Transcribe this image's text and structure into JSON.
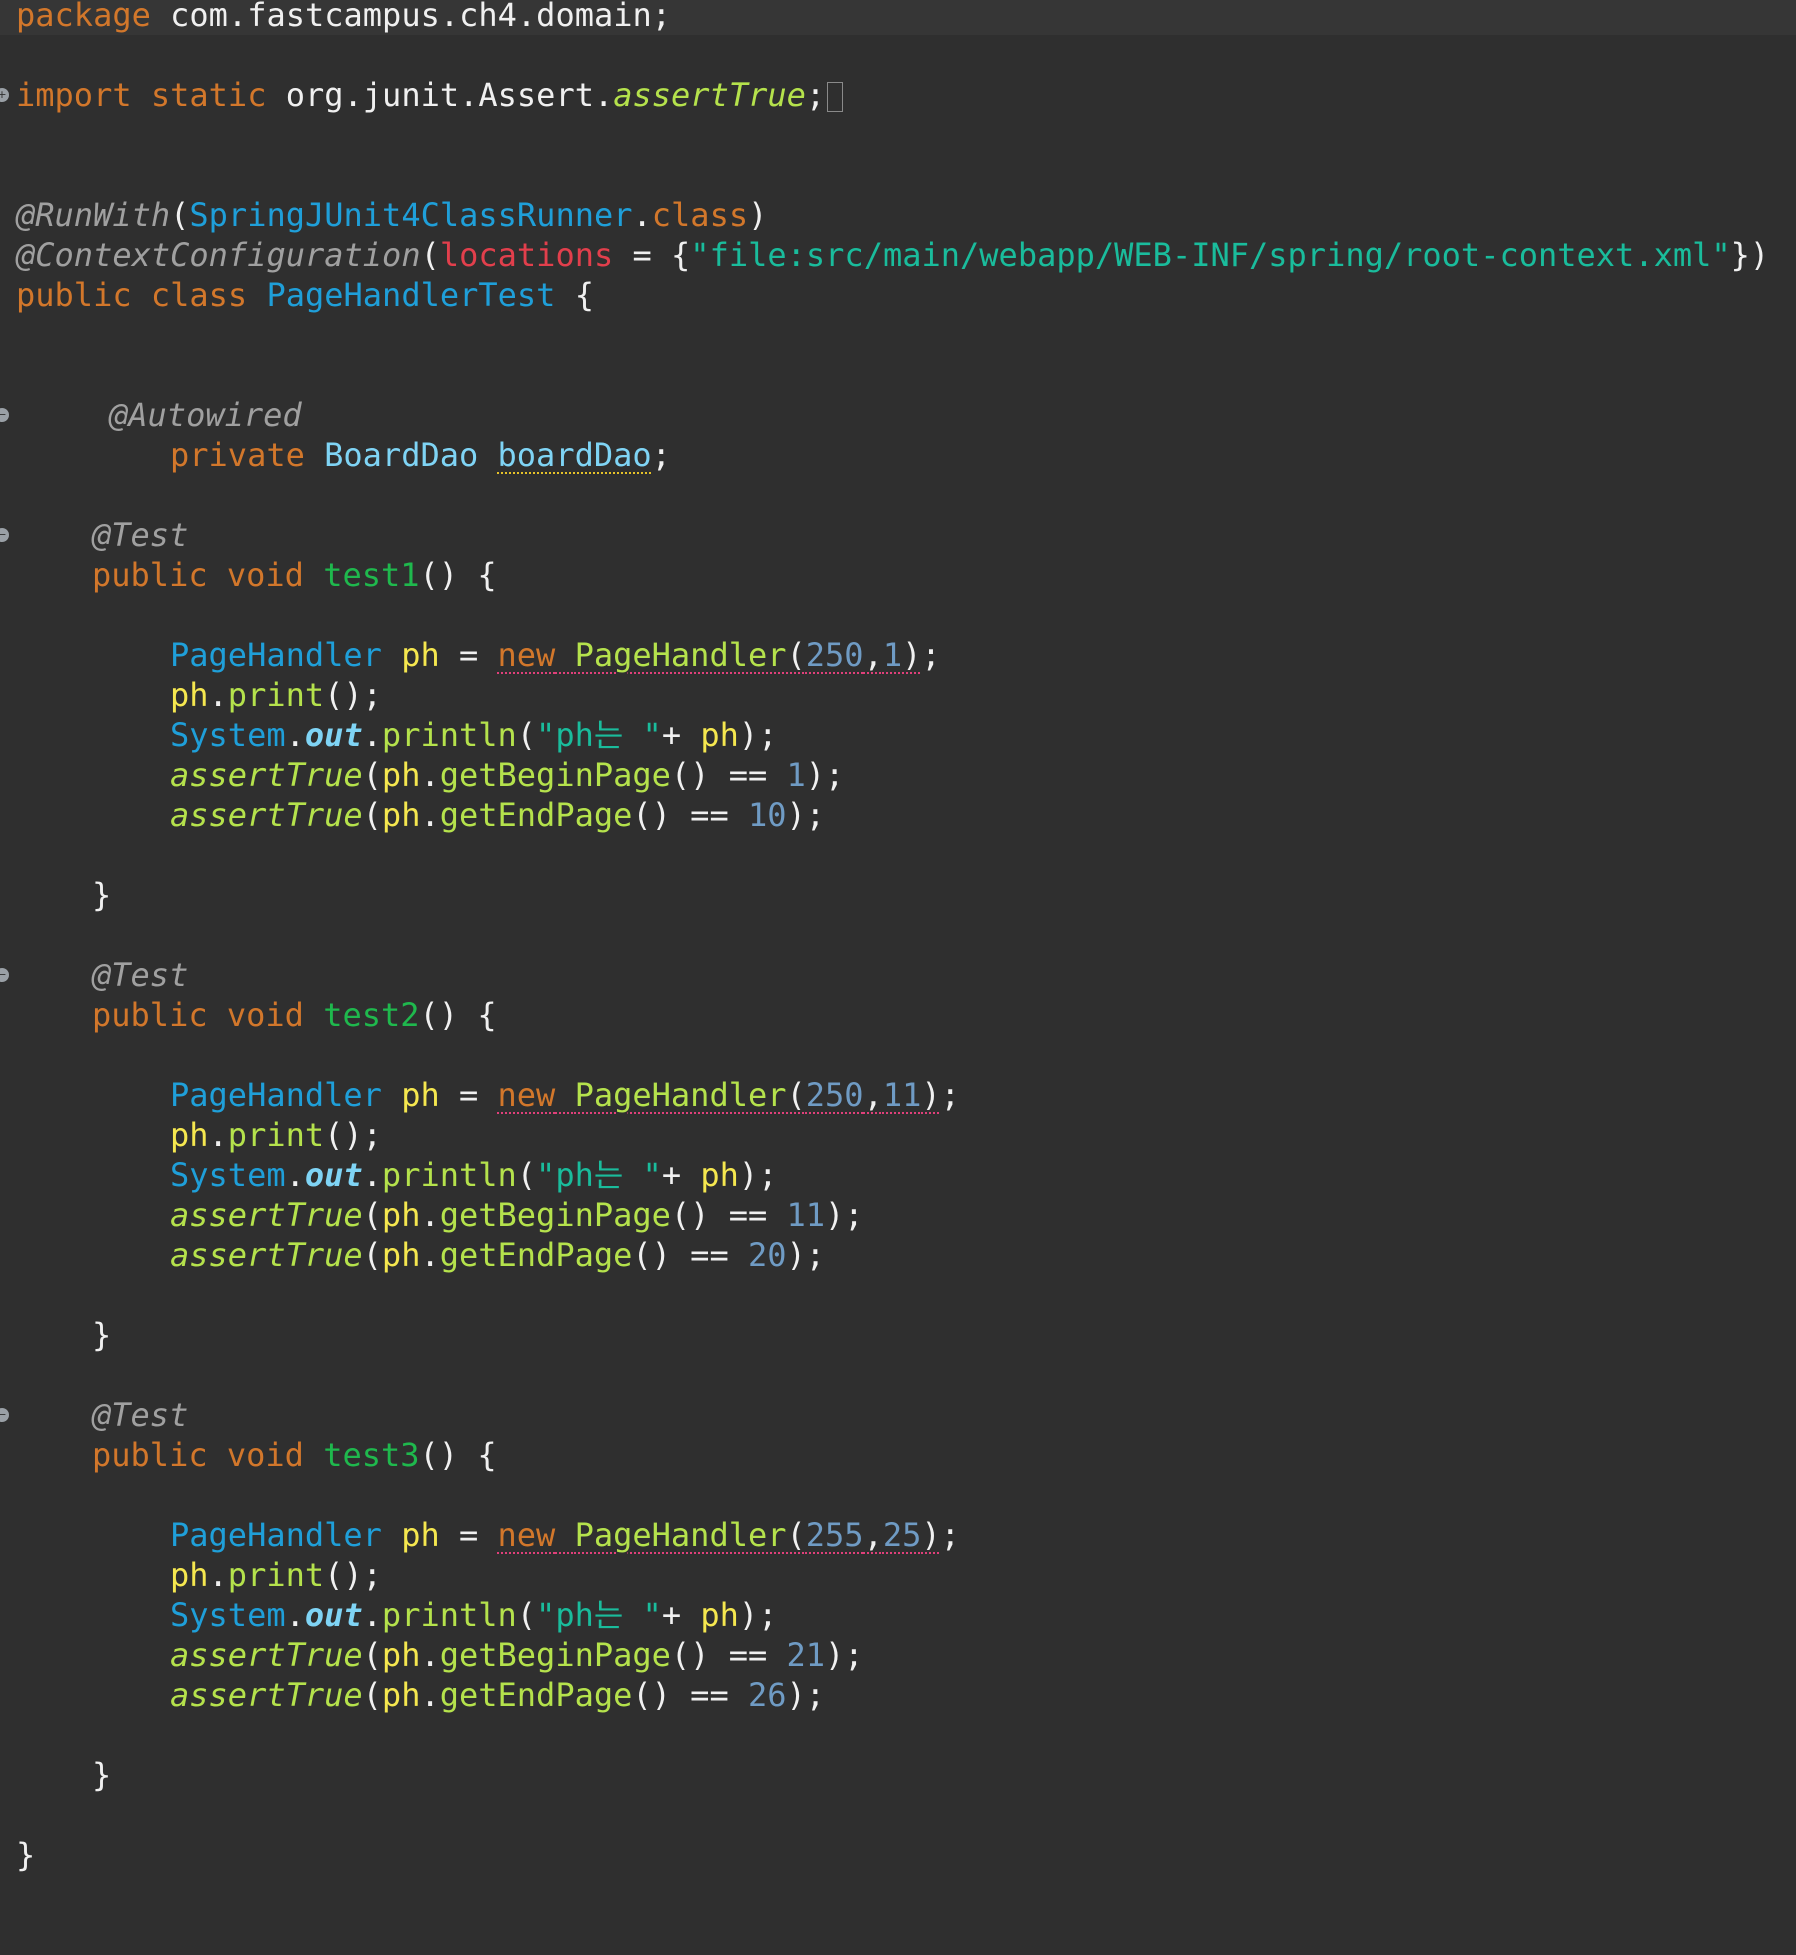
{
  "editor": {
    "package_line": {
      "kw": "package",
      "name": "com.fastcampus.ch4.domain",
      "end": ";"
    },
    "import_line": {
      "kw1": "import",
      "kw2": "static",
      "path": "org.junit.Assert.",
      "method": "assertTrue",
      "end": ";"
    },
    "runwith_line": {
      "ann": "@RunWith",
      "open": "(",
      "cls": "SpringJUnit4ClassRunner",
      "dot": ".",
      "kw": "class",
      "close": ")"
    },
    "context_line": {
      "ann": "@ContextConfiguration",
      "open": "(",
      "attr": "locations",
      "eq": " = {",
      "str": "\"file:src/main/webapp/WEB-INF/spring/root-context.xml\"",
      "close": "})"
    },
    "class_line": {
      "kw1": "public",
      "kw2": "class",
      "name": "PageHandlerTest",
      "brace": " {"
    },
    "autowired_line": {
      "ann": "@Autowired"
    },
    "field_line": {
      "kw": "private",
      "type": "BoardDao",
      "name": "boardDao",
      "end": ";"
    },
    "closing_brace": "}",
    "tests": [
      {
        "annotation": "@Test",
        "kw1": "public",
        "kw2": "void",
        "name": "test1",
        "sig_end": "() {",
        "handler_type": "PageHandler",
        "var": "ph",
        "eq": " = ",
        "new_kw": "new",
        "ctor": "PageHandler",
        "arg1": "250",
        "arg2": "1",
        "print_call": "print",
        "system": "System",
        "out": "out",
        "println": "println",
        "msg": "\"ph는 \"",
        "assert_fn": "assertTrue",
        "begin_getter": "getBeginPage",
        "begin_expected": "1",
        "end_getter": "getEndPage",
        "end_expected": "10",
        "close": "}"
      },
      {
        "annotation": "@Test",
        "kw1": "public",
        "kw2": "void",
        "name": "test2",
        "sig_end": "() {",
        "handler_type": "PageHandler",
        "var": "ph",
        "eq": " = ",
        "new_kw": "new",
        "ctor": "PageHandler",
        "arg1": "250",
        "arg2": "11",
        "print_call": "print",
        "system": "System",
        "out": "out",
        "println": "println",
        "msg": "\"ph는 \"",
        "assert_fn": "assertTrue",
        "begin_getter": "getBeginPage",
        "begin_expected": "11",
        "end_getter": "getEndPage",
        "end_expected": "20",
        "close": "}"
      },
      {
        "annotation": "@Test",
        "kw1": "public",
        "kw2": "void",
        "name": "test3",
        "sig_end": "() {",
        "handler_type": "PageHandler",
        "var": "ph",
        "eq": " = ",
        "new_kw": "new",
        "ctor": "PageHandler",
        "arg1": "255",
        "arg2": "25",
        "print_call": "print",
        "system": "System",
        "out": "out",
        "println": "println",
        "msg": "\"ph는 \"",
        "assert_fn": "assertTrue",
        "begin_getter": "getBeginPage",
        "begin_expected": "21",
        "end_getter": "getEndPage",
        "end_expected": "26",
        "close": "}"
      }
    ]
  },
  "colors": {
    "background": "#2f2f2f",
    "keyword": "#d2772b",
    "type": "#1f9fd9",
    "string": "#1abc9c",
    "number": "#6f9bc4",
    "annotation": "#a0a0a0",
    "method": "#b5e24c",
    "variable": "#f5e74f",
    "field": "#7fd4f5",
    "attribute": "#e23f4c"
  },
  "icons": [
    "fold-marker-icon",
    "folded-imports-icon"
  ]
}
